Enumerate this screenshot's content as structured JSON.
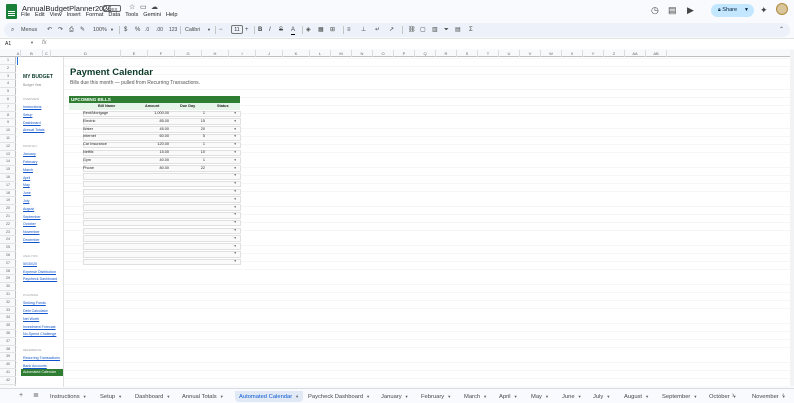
{
  "window": {
    "doc_title": "AnnualBudgetPlanner2026",
    "file_badge": "XLSX",
    "share_label": "Share"
  },
  "menu": [
    "File",
    "Edit",
    "View",
    "Insert",
    "Format",
    "Data",
    "Tools",
    "Gemini",
    "Help"
  ],
  "toolbar": {
    "menus_label": "Menus",
    "zoom": "100%",
    "currency": "$",
    "percent": "%",
    "decimals_less": ".0",
    "decimals_more": ".00",
    "number_format": "123",
    "font": "Calibri",
    "font_size": "11"
  },
  "formula_bar": {
    "cell_ref": "A1",
    "fx": "fx"
  },
  "columns": [
    "A",
    "B",
    "C",
    "D",
    "E",
    "F",
    "G",
    "H",
    "I",
    "J",
    "K",
    "L",
    "M",
    "N",
    "O",
    "P",
    "Q",
    "R",
    "S",
    "T",
    "U",
    "V",
    "W",
    "X",
    "Y",
    "Z",
    "AA",
    "AB"
  ],
  "rows": [
    "1",
    "2",
    "3",
    "4",
    "5",
    "6",
    "7",
    "8",
    "9",
    "10",
    "11",
    "12",
    "13",
    "14",
    "15",
    "16",
    "17",
    "18",
    "19",
    "20",
    "21",
    "22",
    "23",
    "24",
    "25",
    "26",
    "27",
    "28",
    "29",
    "30",
    "31",
    "32",
    "33",
    "34",
    "35",
    "36",
    "37",
    "38",
    "39",
    "40",
    "41",
    "42"
  ],
  "nav": {
    "brand": "MY BUDGET",
    "subtitle": "Budget Year",
    "sections": [
      {
        "title": "OVERVIEW",
        "links": [
          "Instructions",
          "Setup",
          "Dashboard",
          "Annual Totals"
        ]
      },
      {
        "title": "MONTHLY",
        "links": [
          "January",
          "February",
          "March",
          "April",
          "May",
          "June",
          "July",
          "August",
          "September",
          "October",
          "November",
          "December"
        ]
      },
      {
        "title": "ANALYSIS",
        "links": [
          "50/30/20",
          "Expense Distribution",
          "Paycheck Dashboard"
        ]
      },
      {
        "title": "PLANNING",
        "links": [
          "Sinking Funds",
          "Debt Calculator",
          "Net Worth",
          "Investment Forecast",
          "No-Spend Challenge"
        ]
      },
      {
        "title": "REFERENCE",
        "links": [
          "Recurring Transactions",
          "Bank Accounts"
        ]
      }
    ],
    "active_link": "Automated Calendar"
  },
  "main": {
    "title": "Payment Calendar",
    "subtitle": "Bills due this month — pulled from Recurring Transactions.",
    "table": {
      "header": "UPCOMING BILLS",
      "columns": [
        "Bill Name",
        "Amount",
        "Due Day",
        "Status"
      ],
      "rows": [
        {
          "name": "Rent/Mortgage",
          "amount": "1,000.00",
          "due": "1"
        },
        {
          "name": "Electric",
          "amount": "85.00",
          "due": "15"
        },
        {
          "name": "Water",
          "amount": "45.00",
          "due": "20"
        },
        {
          "name": "Internet",
          "amount": "60.00",
          "due": "5"
        },
        {
          "name": "Car Insurance",
          "amount": "120.00",
          "due": "1"
        },
        {
          "name": "Netflix",
          "amount": "15.00",
          "due": "10"
        },
        {
          "name": "Gym",
          "amount": "40.00",
          "due": "1"
        },
        {
          "name": "Phone",
          "amount": "80.00",
          "due": "22"
        }
      ],
      "empty_rows": 12
    }
  },
  "sheet_tabs": [
    "Instructions",
    "Setup",
    "Dashboard",
    "Annual Totals",
    "Automated Calendar",
    "Paycheck Dashboard",
    "January",
    "February",
    "March",
    "April",
    "May",
    "June",
    "July",
    "August",
    "September",
    "October",
    "November"
  ],
  "active_tab": "Automated Calendar"
}
